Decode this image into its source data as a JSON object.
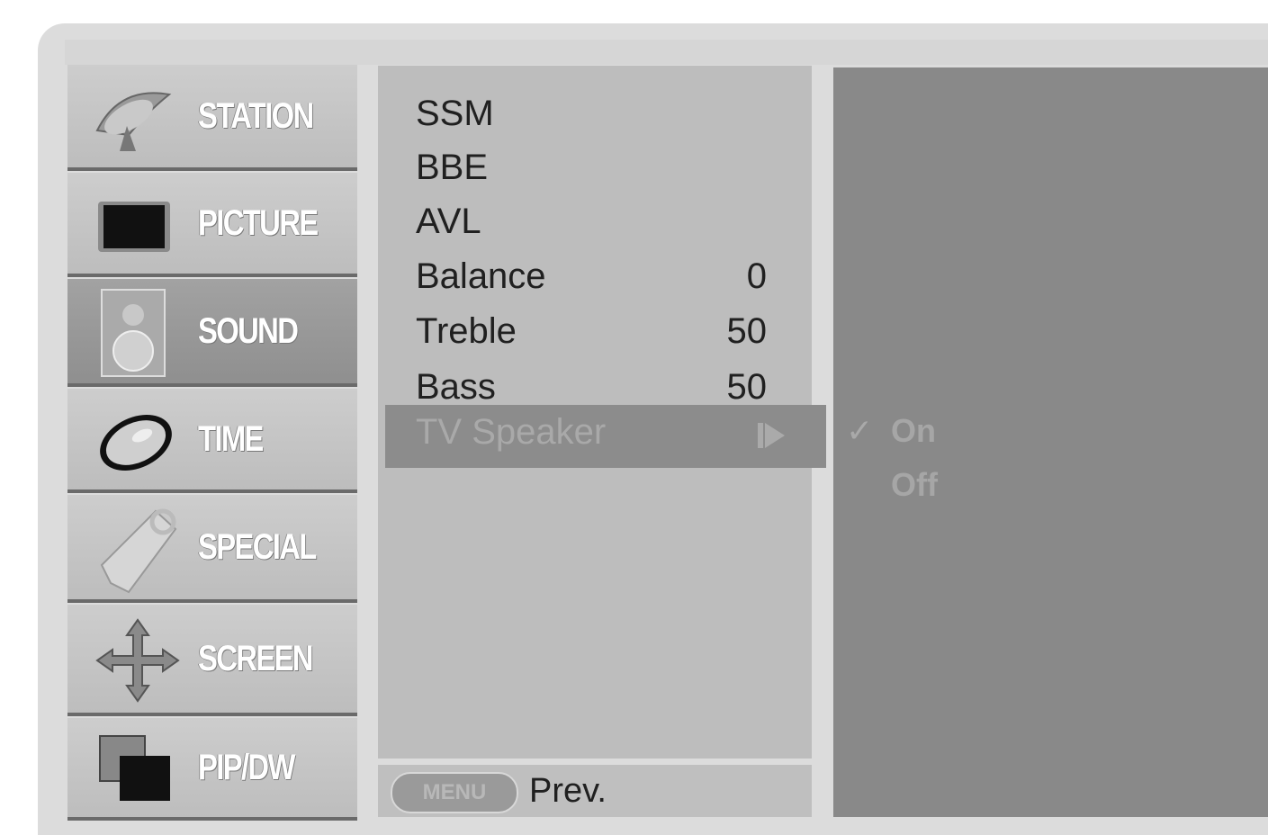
{
  "categories": [
    {
      "label": "STATION",
      "icon": "satellite-dish-icon"
    },
    {
      "label": "PICTURE",
      "icon": "tv-screen-icon"
    },
    {
      "label": "SOUND",
      "icon": "speaker-icon"
    },
    {
      "label": "TIME",
      "icon": "clock-icon"
    },
    {
      "label": "SPECIAL",
      "icon": "tag-icon"
    },
    {
      "label": "SCREEN",
      "icon": "move-arrows-icon"
    },
    {
      "label": "PIP/DW",
      "icon": "pip-windows-icon"
    }
  ],
  "selected_category": "SOUND",
  "sound_menu": {
    "items": [
      {
        "name": "SSM",
        "value": ""
      },
      {
        "name": "BBE",
        "value": ""
      },
      {
        "name": "AVL",
        "value": ""
      },
      {
        "name": "Balance",
        "value": "0"
      },
      {
        "name": "Treble",
        "value": "50"
      },
      {
        "name": "Bass",
        "value": "50"
      }
    ],
    "highlighted": {
      "name": "TV Speaker"
    }
  },
  "tv_speaker_options": {
    "on": "On",
    "off": "Off",
    "checked": "On",
    "check_mark": "✓"
  },
  "footer": {
    "menu_key": "MENU",
    "prev_label": "Prev."
  },
  "colors": {
    "selected_category": "#999999",
    "highlight": "#8c8c8c",
    "option_panel": "#898989"
  }
}
